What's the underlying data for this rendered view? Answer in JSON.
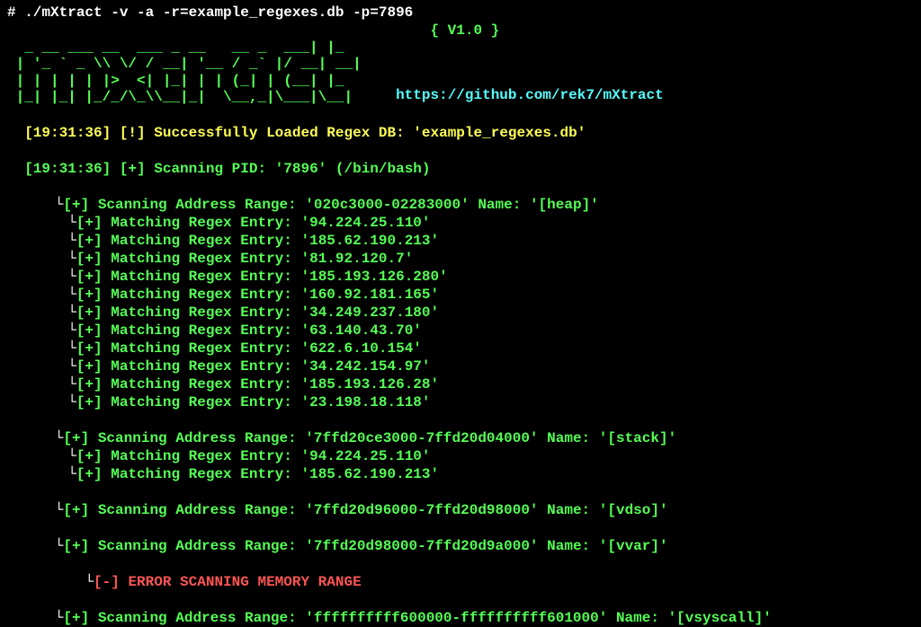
{
  "command": "# ./mXtract -v -a -r=example_regexes.db -p=7896",
  "version": "{ V1.0 }",
  "ascii_art": "  _ __ ___ __  ___ _ __   __ _  ___| |_ \n | '_ ` _ \\\\ \\/ / __| '__ / _` |/ __| __|\n | | | | | |>  <| |_| | | (_| | (__| |_ \n |_| |_| |_/_/\\_\\\\__|_|  \\__,_|\\___|\\__|",
  "url": "https://github.com/rek7/mXtract",
  "loaded": {
    "ts": "[19:31:36]",
    "marker": "[!]",
    "text": "Successfully Loaded Regex DB: 'example_regexes.db'"
  },
  "scanning_pid": {
    "ts": "[19:31:36]",
    "marker": "[+]",
    "text": "Scanning PID: '7896' (/bin/bash)"
  },
  "scan1": {
    "marker": "[+]",
    "label": "Scanning Address Range:",
    "range": "'020c3000-02283000'",
    "name_label": "Name:",
    "name": "'[heap]'"
  },
  "matches1": [
    "'94.224.25.110'",
    "'185.62.190.213'",
    "'81.92.120.7'",
    "'185.193.126.280'",
    "'160.92.181.165'",
    "'34.249.237.180'",
    "'63.140.43.70'",
    "'622.6.10.154'",
    "'34.242.154.97'",
    "'185.193.126.28'",
    "'23.198.18.118'"
  ],
  "match_label": "Matching Regex Entry:",
  "match_marker": "[+]",
  "scan2": {
    "marker": "[+]",
    "label": "Scanning Address Range:",
    "range": "'7ffd20ce3000-7ffd20d04000'",
    "name_label": "Name:",
    "name": "'[stack]'"
  },
  "matches2": [
    "'94.224.25.110'",
    "'185.62.190.213'"
  ],
  "scan3": {
    "marker": "[+]",
    "label": "Scanning Address Range:",
    "range": "'7ffd20d96000-7ffd20d98000'",
    "name_label": "Name:",
    "name": "'[vdso]'"
  },
  "scan4": {
    "marker": "[+]",
    "label": "Scanning Address Range:",
    "range": "'7ffd20d98000-7ffd20d9a000'",
    "name_label": "Name:",
    "name": "'[vvar]'"
  },
  "error": {
    "marker": "[-]",
    "text": "ERROR SCANNING MEMORY RANGE"
  },
  "scan5": {
    "marker": "[+]",
    "label": "Scanning Address Range:",
    "range": "'ffffffffff600000-ffffffffff601000'",
    "name_label": "Name:",
    "name": "'[vsyscall]'"
  },
  "tree_char": "└"
}
